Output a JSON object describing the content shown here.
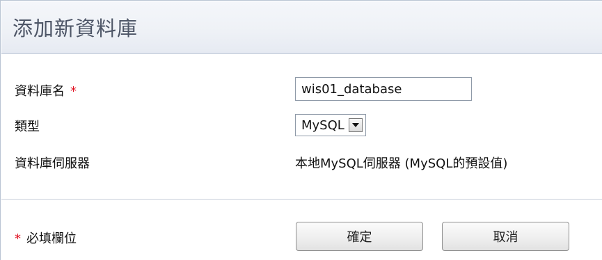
{
  "header": {
    "title": "添加新資料庫"
  },
  "form": {
    "db_name_label": "資料庫名",
    "db_name_value": "wis01_database",
    "required_mark": "*",
    "type_label": "類型",
    "type_value": "MySQL",
    "server_label": "資料庫伺服器",
    "server_value": "本地MySQL伺服器 (MySQL的預設值)",
    "required_note": "必填欄位"
  },
  "buttons": {
    "ok_label": "確定",
    "cancel_label": "取消"
  },
  "colors": {
    "required": "#e01020",
    "title": "#4d5566",
    "header_bg": "#eef1f6",
    "border": "#b9c4d3"
  },
  "icons": {
    "select_arrow": "triangle-down-icon"
  }
}
